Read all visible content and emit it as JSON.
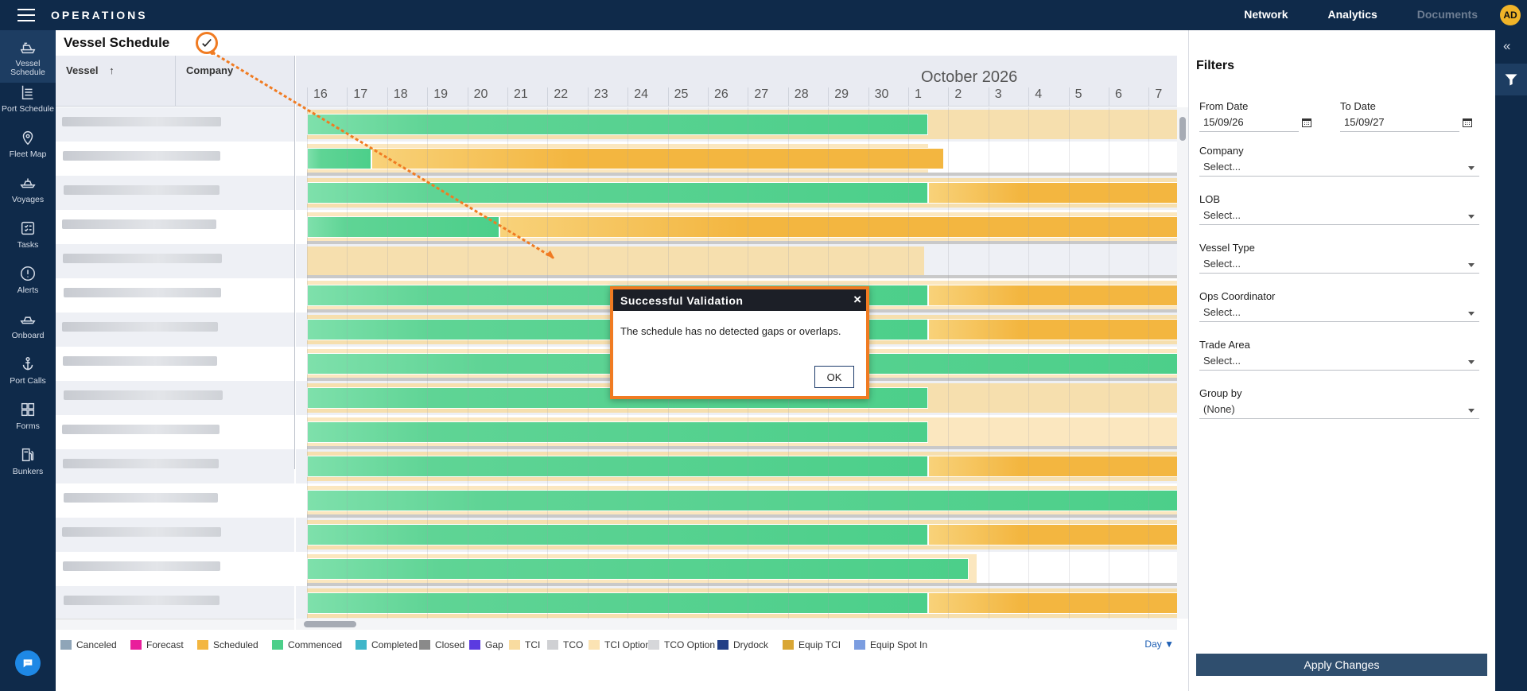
{
  "app": {
    "brand": "OPERATIONS",
    "nav": [
      {
        "label": "Network"
      },
      {
        "label": "Analytics"
      },
      {
        "label": "Documents"
      }
    ],
    "avatar": "AD"
  },
  "sidebar": {
    "items": [
      {
        "label": "Vessel Schedule",
        "icon": "ship-icon"
      },
      {
        "label": "Port Schedule",
        "icon": "calendar-list-icon"
      },
      {
        "label": "Fleet Map",
        "icon": "map-pin-icon"
      },
      {
        "label": "Voyages",
        "icon": "voyage-ship-icon"
      },
      {
        "label": "Tasks",
        "icon": "checklist-icon"
      },
      {
        "label": "Alerts",
        "icon": "alert-icon"
      },
      {
        "label": "Onboard",
        "icon": "onboard-ship-icon"
      },
      {
        "label": "Port Calls",
        "icon": "anchor-icon"
      },
      {
        "label": "Forms",
        "icon": "forms-icon"
      },
      {
        "label": "Bunkers",
        "icon": "fuel-pump-icon"
      }
    ]
  },
  "page": {
    "title": "Vessel Schedule"
  },
  "grid": {
    "col_vessel": "Vessel",
    "col_company": "Company",
    "month": "October 2026",
    "days": [
      "16",
      "17",
      "18",
      "19",
      "20",
      "21",
      "22",
      "23",
      "24",
      "25",
      "26",
      "27",
      "28",
      "29",
      "30",
      "1",
      "2",
      "3",
      "4",
      "5",
      "6",
      "7"
    ]
  },
  "legend": [
    {
      "label": "Canceled",
      "color": "#8fa5b8"
    },
    {
      "label": "Forecast",
      "color": "#e91e9b"
    },
    {
      "label": "Scheduled",
      "color": "#f3b640"
    },
    {
      "label": "Commenced",
      "color": "#4ccf8a"
    },
    {
      "label": "Completed",
      "color": "#3fb6c9"
    },
    {
      "label": "Closed",
      "color": "#8a8a8a"
    },
    {
      "label": "Gap",
      "color": "#5b3be0"
    },
    {
      "label": "TCI",
      "color": "#f9dca0"
    },
    {
      "label": "TCO",
      "color": "#cfd0d3"
    },
    {
      "label": "TCI Option",
      "color": "#fbe3b3"
    },
    {
      "label": "TCO Option",
      "color": "#d6d7da"
    },
    {
      "label": "Drydock",
      "color": "#223f86"
    },
    {
      "label": "Equip TCI",
      "color": "#d9a634"
    },
    {
      "label": "Equip Spot In",
      "color": "#7b9de0"
    }
  ],
  "view_mode": "Day",
  "modal": {
    "title": "Successful Validation",
    "message": "The schedule has no detected gaps or overlaps.",
    "ok_label": "OK"
  },
  "filters": {
    "title": "Filters",
    "from_date_label": "From Date",
    "from_date_value": "15/09/26",
    "to_date_label": "To Date",
    "to_date_value": "15/09/27",
    "fields": [
      {
        "label": "Company",
        "value": "Select..."
      },
      {
        "label": "LOB",
        "value": "Select..."
      },
      {
        "label": "Vessel Type",
        "value": "Select..."
      },
      {
        "label": "Ops Coordinator",
        "value": "Select..."
      },
      {
        "label": "Trade Area",
        "value": "Select..."
      },
      {
        "label": "Group by",
        "value": "(None)"
      }
    ],
    "apply_label": "Apply Changes"
  },
  "rows": [
    {
      "tci_end": 1.0,
      "commenced_end": 15.5,
      "scheduled": null
    },
    {
      "tci_end": 15.5,
      "commenced_end": 1.6,
      "scheduled": [
        1.6,
        15.9
      ]
    },
    {
      "tci_end": 1.0,
      "commenced_end": 15.5,
      "scheduled": [
        15.5,
        22.0
      ]
    },
    {
      "tci_end": 1.0,
      "commenced_end": 4.8,
      "scheduled": [
        4.8,
        22.0
      ]
    },
    {
      "tci_end": 15.4,
      "commenced_end": 0,
      "scheduled": null
    },
    {
      "tci_end": 1.0,
      "commenced_end": 15.5,
      "scheduled": [
        15.5,
        22.0
      ]
    },
    {
      "tci_end": 1.0,
      "commenced_end": 15.5,
      "scheduled": [
        15.5,
        22.0
      ]
    },
    {
      "tci_end": 1.0,
      "commenced_end": 22.0,
      "scheduled": null
    },
    {
      "tci_end": 1.0,
      "commenced_end": 15.5,
      "scheduled": null
    },
    {
      "tci_end": 1.0,
      "commenced_end": 15.5,
      "scheduled": null
    },
    {
      "tci_end": 1.0,
      "commenced_end": 15.5,
      "scheduled": [
        15.5,
        22.0
      ]
    },
    {
      "tci_end": 1.0,
      "commenced_end": 22.0,
      "scheduled": null
    },
    {
      "tci_end": 1.0,
      "commenced_end": 15.5,
      "scheduled": [
        15.5,
        22.0
      ]
    },
    {
      "tci_end": 16.7,
      "commenced_end": 16.5,
      "scheduled": null
    },
    {
      "tci_end": 1.0,
      "commenced_end": 15.5,
      "scheduled": [
        15.5,
        22.0
      ]
    }
  ]
}
